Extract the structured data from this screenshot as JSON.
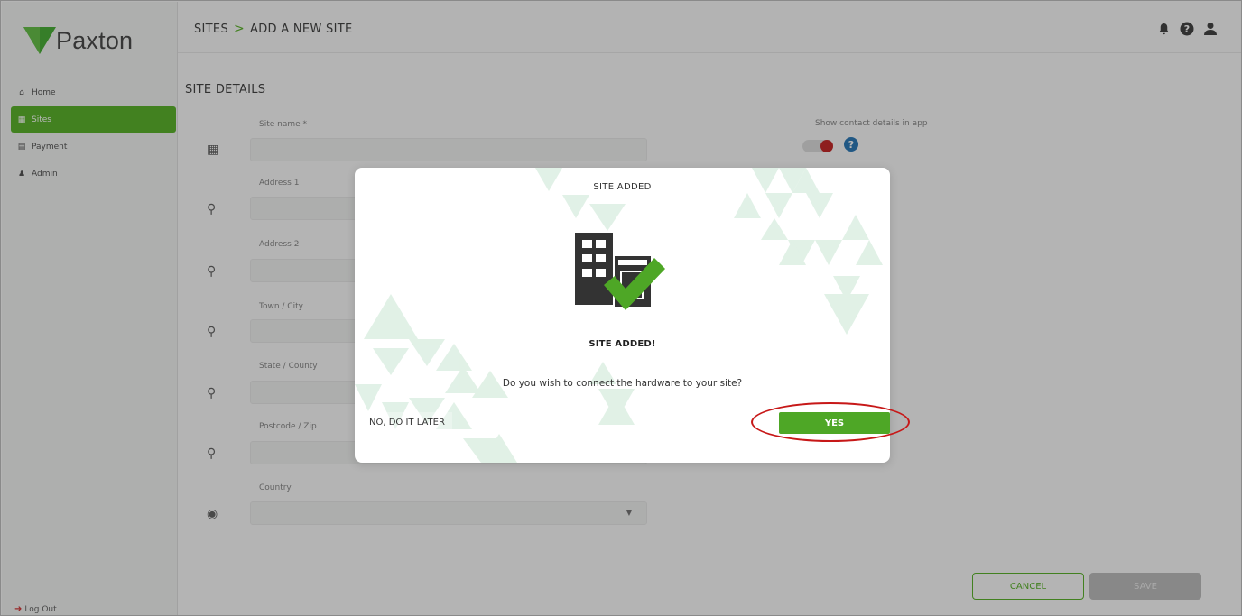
{
  "app": {
    "logo_text": "Paxton"
  },
  "sidebar": {
    "items": [
      {
        "label": "Home",
        "icon": "home-icon",
        "active": false
      },
      {
        "label": "Sites",
        "icon": "building-icon",
        "active": true
      },
      {
        "label": "Payment",
        "icon": "card-icon",
        "active": false
      },
      {
        "label": "Admin",
        "icon": "user-icon",
        "active": false
      }
    ],
    "logout_label": "Log Out"
  },
  "header": {
    "breadcrumb_root": "SITES",
    "breadcrumb_sep": ">",
    "breadcrumb_current": "ADD A NEW SITE",
    "icons": [
      "bell-icon",
      "help-icon",
      "user-icon"
    ]
  },
  "form": {
    "section_title": "SITE DETAILS",
    "fields": [
      {
        "label": "Site name *",
        "icon": "building-icon"
      },
      {
        "label": "Address 1",
        "icon": "map-pin-icon"
      },
      {
        "label": "Address 2",
        "icon": "map-pin-icon"
      },
      {
        "label": "Town / City",
        "icon": "map-pin-icon"
      },
      {
        "label": "State / County",
        "icon": "map-pin-icon"
      },
      {
        "label": "Postcode / Zip",
        "icon": "map-pin-icon"
      },
      {
        "label": "Country",
        "icon": "globe-icon"
      }
    ],
    "contact_toggle_label": "Show contact details in app",
    "help_glyph": "?",
    "cancel_label": "CANCEL",
    "save_label": "SAVE"
  },
  "modal": {
    "title": "SITE ADDED",
    "subtitle": "SITE ADDED!",
    "question": "Do you wish to connect the hardware to your site?",
    "later_label": "NO, DO IT LATER",
    "yes_label": "YES"
  },
  "colors": {
    "brand_green": "#5cb32d",
    "yes_green": "#4ea726",
    "highlight_red": "#c71818",
    "toggle_red": "#c52a2a",
    "help_blue": "#2e7ab8"
  }
}
